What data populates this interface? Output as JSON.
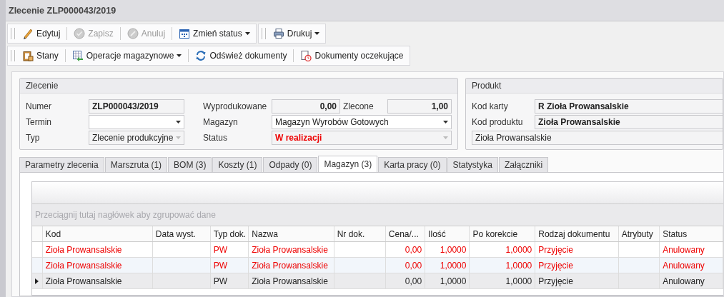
{
  "window": {
    "title": "Zlecenie ZLP000043/2019"
  },
  "toolbar_1": [
    {
      "label": "Edytuj",
      "kind": "pencil",
      "disabled": false,
      "dropdown": false
    },
    {
      "label": "Zapisz",
      "kind": "check",
      "disabled": true,
      "dropdown": false
    },
    {
      "label": "Anuluj",
      "kind": "cancel",
      "disabled": true,
      "dropdown": false
    },
    {
      "label": "Zmień status",
      "kind": "calendar",
      "disabled": false,
      "dropdown": true
    }
  ],
  "toolbar_print": [
    {
      "label": "Drukuj",
      "kind": "printer",
      "disabled": false,
      "dropdown": true
    }
  ],
  "toolbar_2": [
    {
      "label": "Stany",
      "kind": "clipboard",
      "disabled": false,
      "dropdown": false
    },
    {
      "label": "Operacje magazynowe",
      "kind": "table",
      "disabled": false,
      "dropdown": true
    },
    {
      "label": "Odśwież dokumenty",
      "kind": "refresh",
      "disabled": false,
      "dropdown": false
    },
    {
      "label": "Dokumenty oczekujące",
      "kind": "clock",
      "disabled": false,
      "dropdown": false
    }
  ],
  "order": {
    "title": "Zlecenie",
    "numer": {
      "label": "Numer",
      "value": "ZLP000043/2019"
    },
    "termin": {
      "label": "Termin"
    },
    "typ": {
      "label": "Typ",
      "value": "Zlecenie produkcyjne"
    },
    "wyprodukowane": {
      "label": "Wyprodukowane",
      "value": "0,00"
    },
    "zlecone": {
      "label": "Zlecone",
      "value": "1,00"
    },
    "magazyn": {
      "label": "Magazyn",
      "value": "Magazyn Wyrobów Gotowych"
    },
    "status": {
      "label": "Status",
      "value": "W realizacji"
    }
  },
  "product": {
    "title": "Produkt",
    "kod_karty": {
      "label": "Kod karty",
      "value": "R Zioła Prowansalskie"
    },
    "kod_produktu": {
      "label": "Kod produktu",
      "value": "Zioła Prowansalskie"
    },
    "nazwa": {
      "value": "Zioła Prowansalskie"
    }
  },
  "tabs": [
    {
      "label": "Parametry zlecenia",
      "selected": false
    },
    {
      "label": "Marszruta (1)",
      "selected": false
    },
    {
      "label": "BOM (3)",
      "selected": false
    },
    {
      "label": "Koszty (1)",
      "selected": false
    },
    {
      "label": "Odpady (0)",
      "selected": false
    },
    {
      "label": "Magazyn (3)",
      "selected": true
    },
    {
      "label": "Karta pracy (0)",
      "selected": false
    },
    {
      "label": "Statystyka",
      "selected": false
    },
    {
      "label": "Załączniki",
      "selected": false
    }
  ],
  "grid": {
    "group_hint": "Przeciągnij tutaj nagłówek aby zgrupować dane",
    "columns": [
      "Kod",
      "Data wyst.",
      "Typ dok.",
      "Nazwa",
      "Nr dok.",
      "Cena/...",
      "Ilość",
      "Po korekcie",
      "Rodzaj dokumentu",
      "Atrybuty",
      "Status"
    ],
    "rows": [
      {
        "selected": false,
        "error": true,
        "cells": [
          "Zioła Prowansalskie",
          "",
          "PW",
          "Zioła Prowansalskie",
          "",
          "0,00",
          "1,0000",
          "1,0000",
          "Przyjęcie",
          "",
          "Anulowany"
        ]
      },
      {
        "selected": false,
        "error": true,
        "cells": [
          "Zioła Prowansalskie",
          "",
          "PW",
          "Zioła Prowansalskie",
          "",
          "0,00",
          "1,0000",
          "1,0000",
          "Przyjęcie",
          "",
          "Anulowany"
        ]
      },
      {
        "selected": true,
        "error": false,
        "cells": [
          "Zioła Prowansalskie",
          "",
          "PW",
          "Zioła Prowansalskie",
          "",
          "0,00",
          "1,0000",
          "1,0000",
          "Przyjęcie",
          "",
          "Anulowany"
        ]
      }
    ]
  }
}
